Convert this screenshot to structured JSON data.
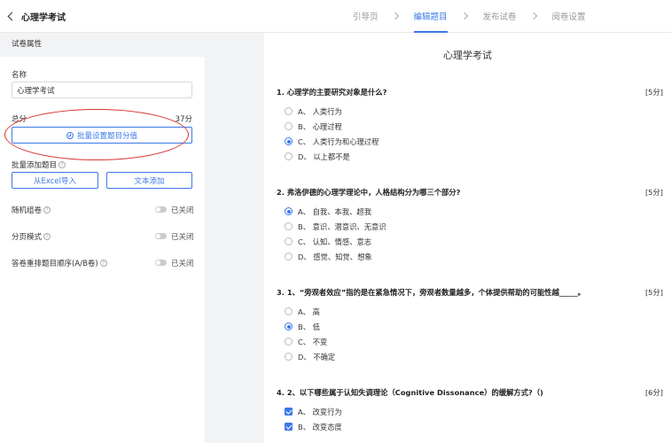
{
  "header": {
    "title": "心理学考试",
    "steps": [
      {
        "label": "引导页",
        "active": false
      },
      {
        "label": "编辑题目",
        "active": true
      },
      {
        "label": "发布试卷",
        "active": false
      },
      {
        "label": "阅卷设置",
        "active": false
      }
    ]
  },
  "sidebar": {
    "section_title": "试卷属性",
    "name_label": "名称",
    "name_value": "心理学考试",
    "total_label": "总分",
    "total_value": "37分",
    "batch_score_button": "批量设置题目分值",
    "batch_add_label": "批量添加题目",
    "import_excel_button": "从Excel导入",
    "text_add_button": "文本添加",
    "switches": [
      {
        "label": "随机组卷",
        "state": "已关闭"
      },
      {
        "label": "分页模式",
        "state": "已关闭"
      },
      {
        "label": "答卷重排题目顺序(A/B卷)",
        "state": "已关闭"
      }
    ]
  },
  "exam": {
    "title": "心理学考试",
    "questions": [
      {
        "text": "1. 心理学的主要研究对象是什么?",
        "points": "[5分]",
        "type": "radio",
        "options": [
          {
            "label": "A、 人类行为",
            "selected": false
          },
          {
            "label": "B、 心理过程",
            "selected": false
          },
          {
            "label": "C、 人类行为和心理过程",
            "selected": true
          },
          {
            "label": "D、 以上都不是",
            "selected": false
          }
        ]
      },
      {
        "text": "2. 弗洛伊德的心理学理论中，人格结构分为哪三个部分?",
        "points": "[5分]",
        "type": "radio",
        "options": [
          {
            "label": "A、 自我、本我、超我",
            "selected": true
          },
          {
            "label": "B、 意识、潜意识、无意识",
            "selected": false
          },
          {
            "label": "C、 认知、情感、意志",
            "selected": false
          },
          {
            "label": "D、 感觉、知觉、想象",
            "selected": false
          }
        ]
      },
      {
        "text": "3. 1、“旁观者效应”指的是在紧急情况下，旁观者数量越多，个体提供帮助的可能性越_____。",
        "points": "[5分]",
        "type": "radio",
        "options": [
          {
            "label": "A、 高",
            "selected": false
          },
          {
            "label": "B、 低",
            "selected": true
          },
          {
            "label": "C、 不变",
            "selected": false
          },
          {
            "label": "D、 不确定",
            "selected": false
          }
        ]
      },
      {
        "text": "4. 2、以下哪些属于认知失调理论（Cognitive Dissonance）的缓解方式?（)",
        "points": "[6分]",
        "type": "checkbox",
        "options": [
          {
            "label": "A、 改变行为",
            "selected": true
          },
          {
            "label": "B、 改变态度",
            "selected": true
          }
        ]
      }
    ]
  },
  "colors": {
    "accent": "#3b78e7",
    "panel_gray": "#f2f3f5",
    "annotation_red": "#d93030"
  }
}
